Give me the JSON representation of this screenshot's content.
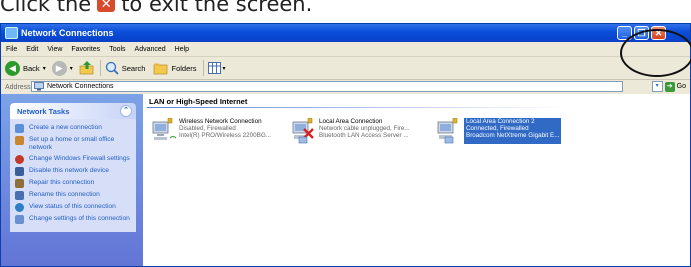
{
  "caption": {
    "before": "Click the",
    "after": "to exit the screen."
  },
  "window": {
    "title": "Network Connections",
    "controls": [
      "_",
      "❐",
      "✕"
    ]
  },
  "menu": [
    "File",
    "Edit",
    "View",
    "Favorites",
    "Tools",
    "Advanced",
    "Help"
  ],
  "toolbar": {
    "back": "Back",
    "search": "Search",
    "folders": "Folders"
  },
  "address": {
    "label": "Address",
    "value": "Network Connections",
    "go": "Go"
  },
  "network_tasks": {
    "title": "Network Tasks",
    "items": [
      {
        "label": "Create a new connection",
        "icon": "new-connection-icon"
      },
      {
        "label": "Set up a home or small office network",
        "icon": "home-network-icon"
      },
      {
        "label": "Change Windows Firewall settings",
        "icon": "firewall-icon"
      },
      {
        "label": "Disable this network device",
        "icon": "disable-device-icon"
      },
      {
        "label": "Repair this connection",
        "icon": "repair-icon"
      },
      {
        "label": "Rename this connection",
        "icon": "rename-icon"
      },
      {
        "label": "View status of this connection",
        "icon": "status-icon"
      },
      {
        "label": "Change settings of this connection",
        "icon": "settings-icon"
      }
    ]
  },
  "section": {
    "title": "LAN or High-Speed Internet"
  },
  "connections": [
    {
      "name": "Wireless Network Connection",
      "status": "Disabled, Firewalled",
      "device": "Intel(R) PRO/Wireless 2200BG..."
    },
    {
      "name": "Local Area Connection",
      "status": "Network cable unplugged, Fire...",
      "device": "Bluetooth LAN Access Server ..."
    },
    {
      "name": "Local Area Connection 2",
      "status": "Connected, Firewalled",
      "device": "Broadcom NetXtreme Gigabit E..."
    }
  ]
}
